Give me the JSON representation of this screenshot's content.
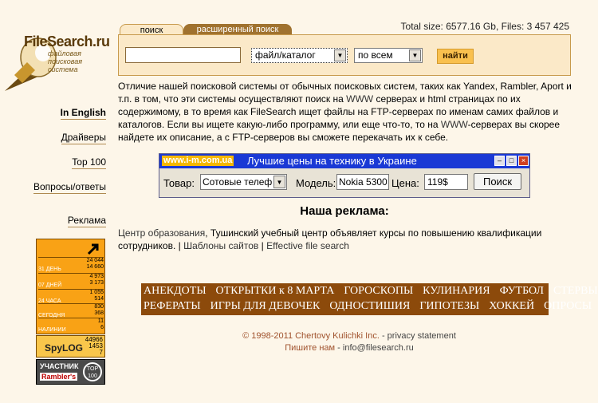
{
  "header": {
    "logo_title": "FileSearch.ru",
    "logo_sub_1": "файловая",
    "logo_sub_2": "поисковая",
    "logo_sub_3": "система",
    "total_size": "Total size: 6577.16 Gb, Files: 3 457 425"
  },
  "search": {
    "tab_search": "поиск",
    "tab_extended": "расширенный поиск",
    "query_value": "",
    "type_select": "файл/каталог",
    "scope_select": "по всем",
    "find_button": "найти"
  },
  "nav": {
    "english": "In English",
    "drivers": "Драйверы",
    "top100": "Top 100",
    "faq": "Вопросы/ответы",
    "ads": "Реклама"
  },
  "description": {
    "p1": "Отличие нашей поисковой системы от обычных поисковых систем, таких как Yandex, Rambler, Aport и т.п. в том, что эти системы осуществляют поиск на ",
    "www1": "WWW",
    "p2": " серверах и html страницах по их содержимому, в то время как FileSearch ищет файлы на FTP-серверах по именам самих файлов и каталогов. Если вы ищете какую-либо программу, или еще что-то, то на ",
    "www2": "WWW",
    "p3": "-серверах вы скорее найдете их описание, а с FTP-серверов вы сможете перекачать их к себе."
  },
  "banner": {
    "url": "www.i-m.com.ua",
    "slogan": "Лучшие цены на технику в Украине",
    "label_product": "Товар:",
    "product_value": "Сотовые телеф",
    "label_model": "Модель:",
    "model_value": "Nokia 5300",
    "label_price": "Цена:",
    "price_value": "119$",
    "find_button": "Поиск"
  },
  "ads": {
    "heading": "Наша реклама:",
    "link1": "Центр образования",
    "sep1": ", ",
    "text1": "Тушинский учебный центр объявляет курсы по повышению квалификации сотрудников.",
    "sep2": " | ",
    "link2": "Шаблоны сайтов",
    "sep3": " | ",
    "link3": "Effective file search"
  },
  "linkbar": {
    "row1": [
      "АНЕКДОТЫ",
      "ОТКРЫТКИ к 8 МАРТА",
      "ГОРОСКОПЫ",
      "КУЛИНАРИЯ",
      "ФУТБОЛ",
      "СТЕРВЫ"
    ],
    "row2": [
      "РЕФЕРАТЫ",
      "ИГРЫ ДЛЯ ДЕВОЧЕК",
      "ОДНОСТИШИЯ",
      "ГИПОТЕЗЫ",
      "ХОККЕЙ",
      "ОПРОСЫ"
    ]
  },
  "counter": {
    "rows": [
      {
        "label": "31 ДЕНЬ",
        "v1": "24 044",
        "v2": "14 660"
      },
      {
        "label": "07 ДНЕЙ",
        "v1": "4 973",
        "v2": "3 173"
      },
      {
        "label": "24 ЧАСА",
        "v1": "1 055",
        "v2": "514"
      },
      {
        "label": "СЕГОДНЯ",
        "v1": "830",
        "v2": "368"
      },
      {
        "label": "НАЛИНИИ",
        "v1": "11",
        "v2": "6"
      }
    ],
    "spylog_text": "SpyLOG",
    "spylog_n1": "44966",
    "spylog_n2": "1453",
    "spylog_n3": "7",
    "rambler_a": "УЧАСТНИК",
    "rambler_b": "Rambler's",
    "rambler_c": "TOP 100"
  },
  "footer": {
    "copyright": "© 1998-2011 Chertovy Kulichki Inc.",
    "sep": "  - ",
    "privacy": "privacy statement",
    "write_us": "Пишите нам",
    "sep2": " - ",
    "email": "info@filesearch.ru"
  }
}
